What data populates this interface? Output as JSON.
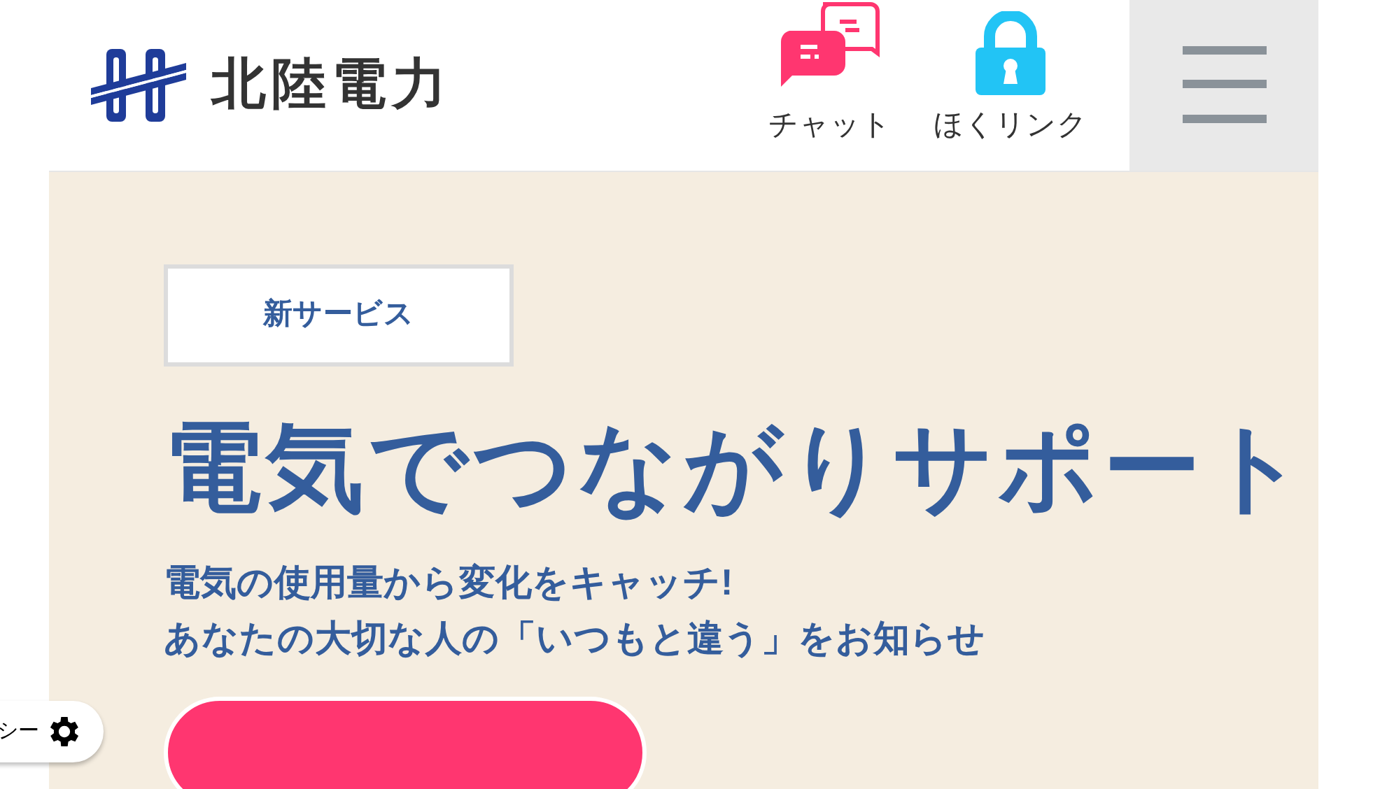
{
  "header": {
    "logo_text": "北陸電力",
    "links": [
      {
        "label": "チャット",
        "kind": "chat"
      },
      {
        "label": "ほくリンク",
        "kind": "lock"
      }
    ]
  },
  "hero": {
    "badge": "新サービス",
    "title": "電気でつながりサポート",
    "subtitle_lines": [
      "電気の使用量から変化をキャッチ!",
      "あなたの大切な人の「いつもと違う」をお知らせ"
    ]
  },
  "floating_button": {
    "label": "シー"
  }
}
